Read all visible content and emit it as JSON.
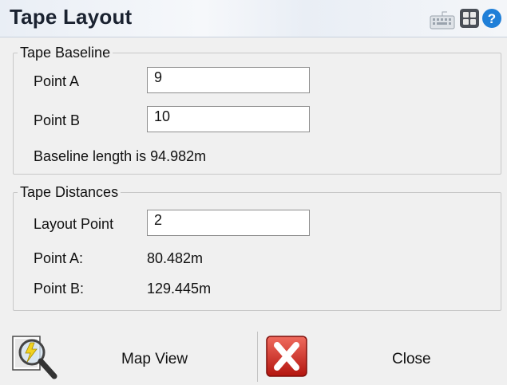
{
  "window": {
    "title": "Tape Layout"
  },
  "toolbar_icons": [
    "keyboard-icon",
    "grid-icon",
    "help-icon"
  ],
  "colors": {
    "help": "#1f7fd8",
    "close_red": "#d42a26",
    "accent": "#1a2230"
  },
  "baseline_group": {
    "label": "Tape Baseline",
    "point_a_label": "Point A",
    "point_a_value": "9",
    "point_b_label": "Point B",
    "point_b_value": "10",
    "length_text": "Baseline length is 94.982m"
  },
  "distances_group": {
    "label": "Tape Distances",
    "layout_point_label": "Layout Point",
    "layout_point_value": "2",
    "point_a_label": "Point A:",
    "point_a_value": "80.482m",
    "point_b_label": "Point B:",
    "point_b_value": "129.445m"
  },
  "footer": {
    "map_view_label": "Map View",
    "close_label": "Close"
  }
}
